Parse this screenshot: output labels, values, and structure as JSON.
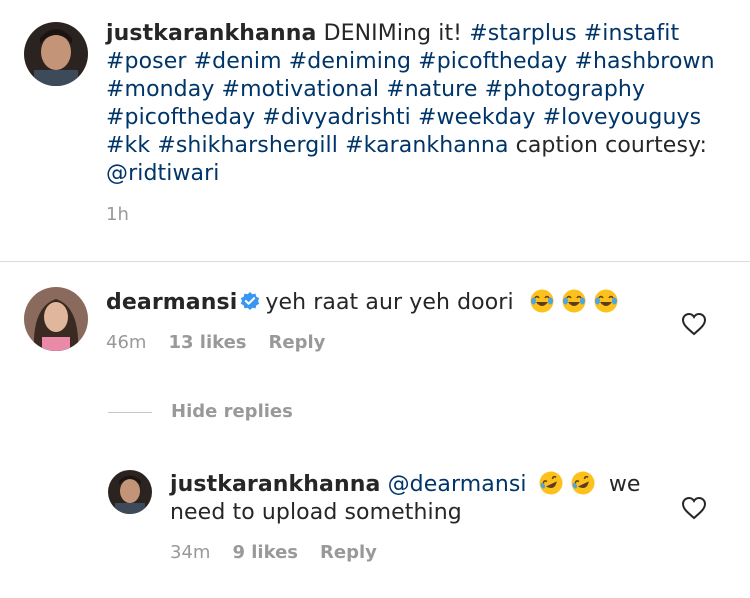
{
  "post": {
    "username": "justkarankhanna",
    "caption_text": "DENIMing it!",
    "hashtags_line1": [
      "#starplus",
      "#instafit"
    ],
    "hashtags_line2": [
      "#poser",
      "#denim",
      "#deniming",
      "#picoftheday",
      "#hashbrown"
    ],
    "hashtags_line3": [
      "#monday",
      "#motivational",
      "#nature",
      "#photography"
    ],
    "hashtags_line4": [
      "#picoftheday",
      "#divyadrishti",
      "#weekday",
      "#loveyouguys"
    ],
    "hashtags_line5": [
      "#kk",
      "#shikharshergill",
      "#karankhanna"
    ],
    "trailing_text": "caption courtesy:",
    "mention": "@ridtiwari",
    "time": "1h"
  },
  "comment": {
    "username": "dearmansi",
    "verified": true,
    "text": "yeh raat aur yeh doori",
    "emojis": [
      "face-with-tears-of-joy",
      "face-with-tears-of-joy",
      "face-with-tears-of-joy"
    ],
    "time": "46m",
    "likes": "13 likes",
    "reply_label": "Reply"
  },
  "replies_toggle": {
    "label": "Hide replies"
  },
  "reply": {
    "username": "justkarankhanna",
    "mention": "@dearmansi",
    "emojis": [
      "rolling-on-floor-laughing",
      "rolling-on-floor-laughing"
    ],
    "text_part1": "we",
    "text_part2": "need to upload something",
    "time": "34m",
    "likes": "9 likes",
    "reply_label": "Reply"
  },
  "colors": {
    "link": "#003569",
    "meta": "#999999",
    "verified": "#3897f0",
    "text": "#262626"
  }
}
